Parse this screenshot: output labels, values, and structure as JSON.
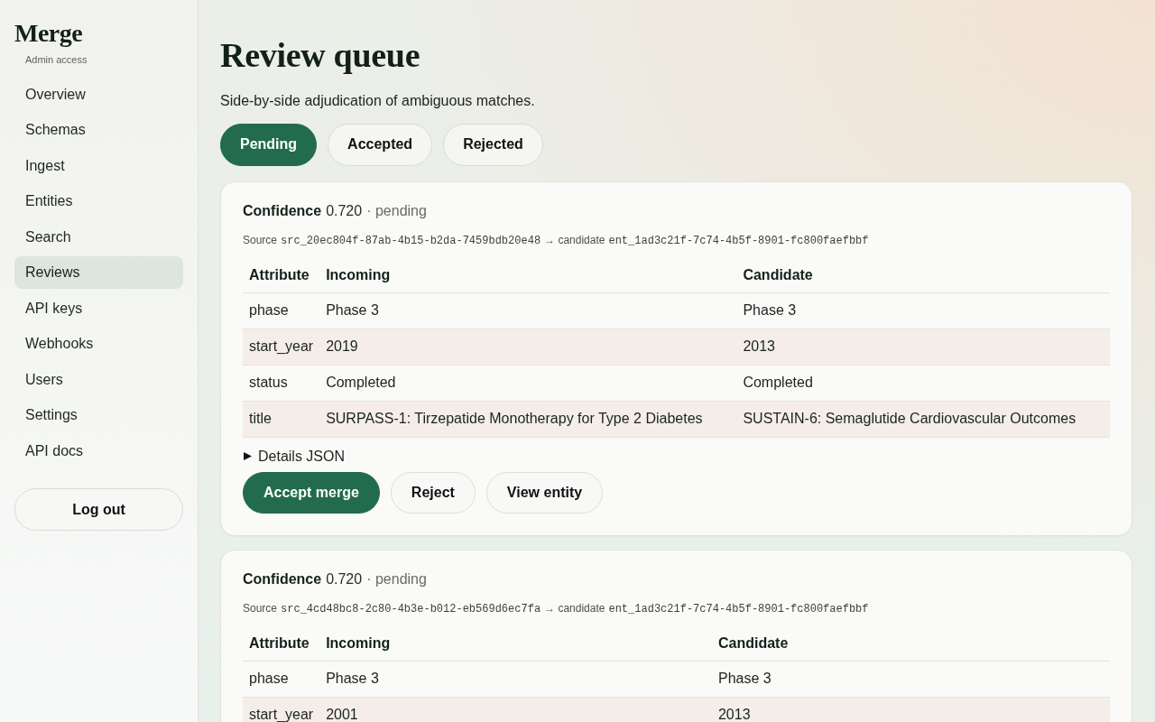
{
  "sidebar": {
    "title": "Merge",
    "subtitle": "Admin access",
    "items": [
      {
        "label": "Overview",
        "selected": false
      },
      {
        "label": "Schemas",
        "selected": false
      },
      {
        "label": "Ingest",
        "selected": false
      },
      {
        "label": "Entities",
        "selected": false
      },
      {
        "label": "Search",
        "selected": false
      },
      {
        "label": "Reviews",
        "selected": true
      },
      {
        "label": "API keys",
        "selected": false
      },
      {
        "label": "Webhooks",
        "selected": false
      },
      {
        "label": "Users",
        "selected": false
      },
      {
        "label": "Settings",
        "selected": false
      },
      {
        "label": "API docs",
        "selected": false
      }
    ],
    "logout": "Log out"
  },
  "header": {
    "title": "Review queue",
    "subtitle": "Side-by-side adjudication of ambiguous matches."
  },
  "tabs": [
    {
      "label": "Pending",
      "selected": true
    },
    {
      "label": "Accepted",
      "selected": false
    },
    {
      "label": "Rejected",
      "selected": false
    }
  ],
  "reviews": [
    {
      "confidence_label": "Confidence",
      "confidence": "0.720",
      "status": "· pending",
      "source_label": "Source",
      "source_id": "src_20ec804f-87ab-4b15-b2da-7459bdb20e48",
      "candidate_label": "→ candidate",
      "candidate_id": "ent_1ad3c21f-7c74-4b5f-8901-fc800faefbbf",
      "table": {
        "columns": [
          "Attribute",
          "Incoming",
          "Candidate"
        ],
        "rows": [
          {
            "cells": [
              "phase",
              "Phase 3",
              "Phase 3"
            ],
            "highlighted": false
          },
          {
            "cells": [
              "start_year",
              "2019",
              "2013"
            ],
            "highlighted": true
          },
          {
            "cells": [
              "status",
              "Completed",
              "Completed"
            ],
            "highlighted": false
          },
          {
            "cells": [
              "title",
              "SURPASS-1: Tirzepatide Monotherapy for Type 2 Diabetes",
              "SUSTAIN-6: Semaglutide Cardiovascular Outcomes"
            ],
            "highlighted": true
          }
        ]
      },
      "details": {
        "label": "Details JSON",
        "expanded": false
      },
      "actions": [
        {
          "label": "Accept merge",
          "kind": "primary"
        },
        {
          "label": "Reject",
          "kind": "secondary"
        },
        {
          "label": "View entity",
          "kind": "secondary"
        }
      ]
    },
    {
      "confidence_label": "Confidence",
      "confidence": "0.720",
      "status": "· pending",
      "source_label": "Source",
      "source_id": "src_4cd48bc8-2c80-4b3e-b012-eb569d6ec7fa",
      "candidate_label": "→ candidate",
      "candidate_id": "ent_1ad3c21f-7c74-4b5f-8901-fc800faefbbf",
      "table": {
        "columns": [
          "Attribute",
          "Incoming",
          "Candidate"
        ],
        "rows": [
          {
            "cells": [
              "phase",
              "Phase 3",
              "Phase 3"
            ],
            "highlighted": false
          },
          {
            "cells": [
              "start_year",
              "2001",
              "2013"
            ],
            "highlighted": true
          }
        ]
      }
    }
  ]
}
